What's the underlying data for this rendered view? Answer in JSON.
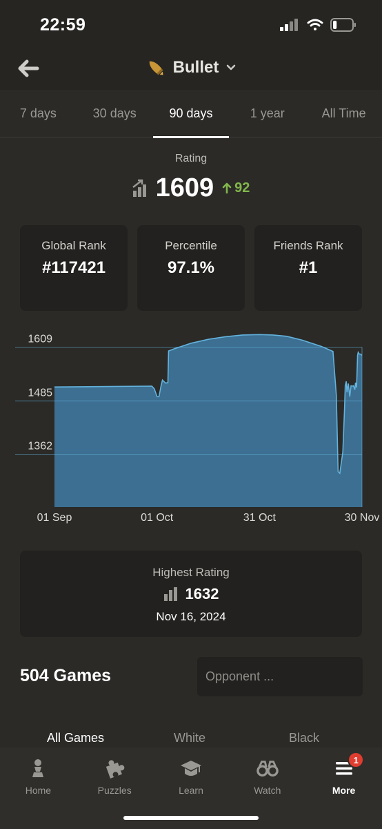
{
  "status_bar": {
    "time": "22:59",
    "battery_level": 0.2
  },
  "header": {
    "title": "Bullet",
    "icon": "bullet-rocket-icon"
  },
  "tabs": [
    {
      "label": "7 days",
      "active": false
    },
    {
      "label": "30 days",
      "active": false
    },
    {
      "label": "90 days",
      "active": true
    },
    {
      "label": "1 year",
      "active": false
    },
    {
      "label": "All Time",
      "active": false
    }
  ],
  "rating": {
    "label": "Rating",
    "value": "1609",
    "change": "92",
    "change_color": "#81b64c"
  },
  "stats": [
    {
      "label": "Global Rank",
      "value": "#117421"
    },
    {
      "label": "Percentile",
      "value": "97.1%"
    },
    {
      "label": "Friends Rank",
      "value": "#1"
    }
  ],
  "chart_data": {
    "type": "area",
    "color": "#3c6f91",
    "line_color": "#63b3de",
    "yticks": [
      "1609",
      "1485",
      "1362"
    ],
    "ylim": [
      1240,
      1648
    ],
    "xlim": [
      0,
      90
    ],
    "x_ticks": [
      {
        "label": "01 Sep",
        "x": 0
      },
      {
        "label": "01 Oct",
        "x": 30
      },
      {
        "label": "31 Oct",
        "x": 60
      },
      {
        "label": "30 Nov",
        "x": 90
      }
    ],
    "series": [
      {
        "x": [
          0,
          15,
          28.5,
          29.2,
          30.0,
          30.6,
          31.2,
          31.6,
          32.5,
          33.2,
          33.4,
          35,
          40,
          45,
          50,
          55,
          60,
          64,
          68,
          70,
          72.5,
          78,
          81.5,
          82.5,
          83,
          83.5,
          84.4,
          84.9,
          85.1,
          85.4,
          85.6,
          86.0,
          86.4,
          86.8,
          87.3,
          87.5,
          87.9,
          88.1,
          88.4,
          88.7,
          88.9,
          89.2,
          89.6,
          90
        ],
        "y": [
          1517,
          1518,
          1519,
          1513,
          1495,
          1495,
          1520,
          1533,
          1526,
          1527,
          1600,
          1605,
          1618,
          1627,
          1633,
          1637,
          1638,
          1637,
          1634,
          1630,
          1625,
          1611,
          1599,
          1497,
          1322,
          1318,
          1367,
          1468,
          1520,
          1530,
          1505,
          1525,
          1495,
          1520,
          1519,
          1520,
          1511,
          1527,
          1516,
          1590,
          1597,
          1593,
          1593,
          1590
        ]
      }
    ]
  },
  "highest_rating": {
    "label": "Highest Rating",
    "value": "1632",
    "date": "Nov 16, 2024"
  },
  "games": {
    "count_label": "504 Games",
    "search_placeholder": "Opponent ..."
  },
  "game_filters": [
    {
      "label": "All Games",
      "active": true
    },
    {
      "label": "White",
      "active": false
    },
    {
      "label": "Black",
      "active": false
    }
  ],
  "bottom_nav": [
    {
      "label": "Home",
      "icon": "pawn-icon",
      "active": false
    },
    {
      "label": "Puzzles",
      "icon": "puzzle-icon",
      "active": false
    },
    {
      "label": "Learn",
      "icon": "graduation-cap-icon",
      "active": false
    },
    {
      "label": "Watch",
      "icon": "binoculars-icon",
      "active": false
    },
    {
      "label": "More",
      "icon": "menu-icon",
      "active": true,
      "badge": "1"
    }
  ]
}
